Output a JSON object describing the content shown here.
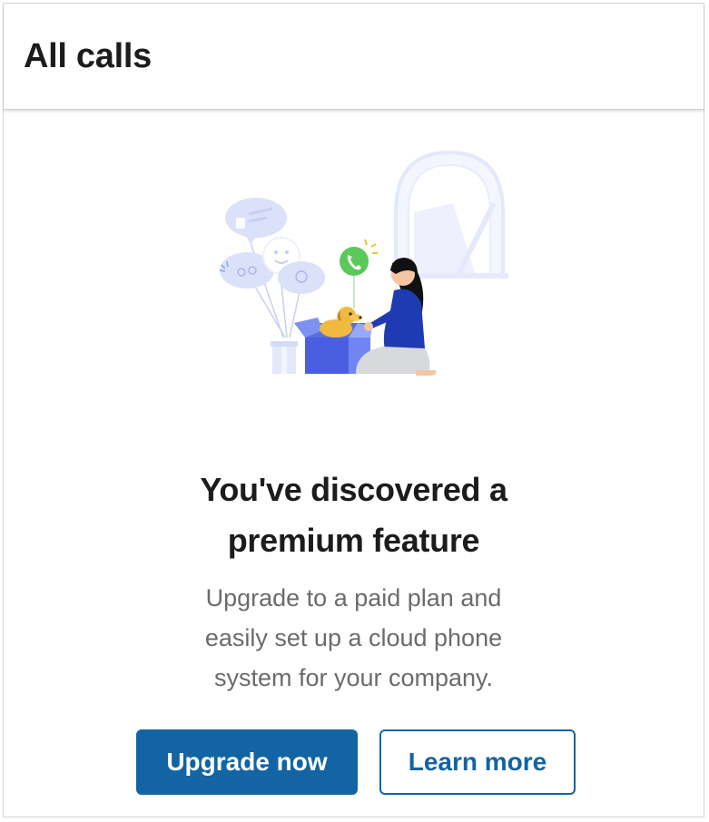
{
  "header": {
    "title": "All calls"
  },
  "main": {
    "illustration_icon": "gift-box-puppy-phone-illustration",
    "headline_line1": "You've discovered a",
    "headline_line2": "premium feature",
    "description_line1": "Upgrade to a paid plan and",
    "description_line2": "easily set up a cloud phone",
    "description_line3": "system for your company.",
    "upgrade_label": "Upgrade now",
    "learn_more_label": "Learn more"
  },
  "colors": {
    "primary": "#1264a3",
    "heading_text": "#1d1c1d",
    "body_text": "#6b6b6b",
    "phone_badge": "#5ac85a"
  }
}
